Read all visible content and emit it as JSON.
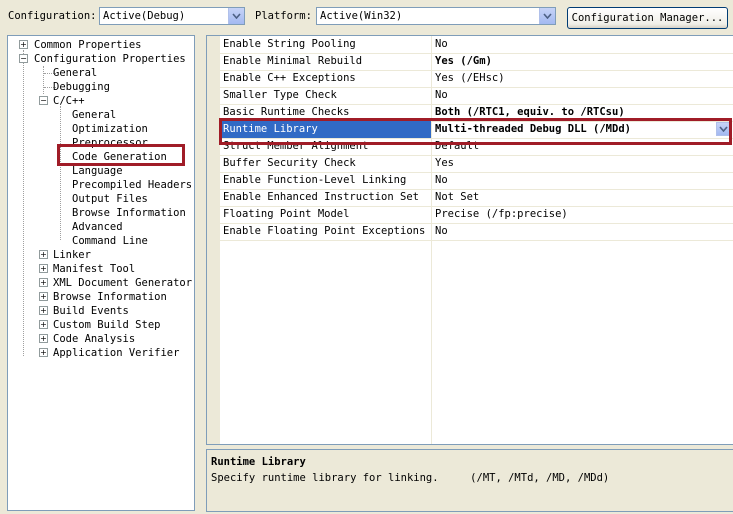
{
  "toolbar": {
    "configuration_label": "Configuration:",
    "configuration_value": "Active(Debug)",
    "platform_label": "Platform:",
    "platform_value": "Active(Win32)",
    "config_manager_label": "Configuration Manager..."
  },
  "tree": {
    "common_properties": "Common Properties",
    "configuration_properties": "Configuration Properties",
    "general": "General",
    "debugging": "Debugging",
    "cc": "C/C++",
    "cc_children": [
      "General",
      "Optimization",
      "Preprocessor",
      "Code Generation",
      "Language",
      "Precompiled Headers",
      "Output Files",
      "Browse Information",
      "Advanced",
      "Command Line"
    ],
    "other_nodes": [
      "Linker",
      "Manifest Tool",
      "XML Document Generator",
      "Browse Information",
      "Build Events",
      "Custom Build Step",
      "Code Analysis",
      "Application Verifier"
    ]
  },
  "properties": [
    {
      "name": "Enable String Pooling",
      "value": "No"
    },
    {
      "name": "Enable Minimal Rebuild",
      "value": "Yes (/Gm)",
      "bold": true
    },
    {
      "name": "Enable C++ Exceptions",
      "value": "Yes (/EHsc)"
    },
    {
      "name": "Smaller Type Check",
      "value": "No"
    },
    {
      "name": "Basic Runtime Checks",
      "value": "Both (/RTC1, equiv. to /RTCsu)",
      "bold": true
    },
    {
      "name": "Runtime Library",
      "value": "Multi-threaded Debug DLL (/MDd)",
      "bold": true,
      "selected": true
    },
    {
      "name": "Struct Member Alignment",
      "value": "Default"
    },
    {
      "name": "Buffer Security Check",
      "value": "Yes"
    },
    {
      "name": "Enable Function-Level Linking",
      "value": "No"
    },
    {
      "name": "Enable Enhanced Instruction Set",
      "value": "Not Set"
    },
    {
      "name": "Floating Point Model",
      "value": "Precise (/fp:precise)"
    },
    {
      "name": "Enable Floating Point Exceptions",
      "value": "No"
    }
  ],
  "description": {
    "title": "Runtime Library",
    "text": "Specify runtime library for linking.     (/MT, /MTd, /MD, /MDd)"
  },
  "colors": {
    "selection": "#316ac5",
    "highlight_box": "#a01c27",
    "window_bg": "#ece9d8"
  }
}
